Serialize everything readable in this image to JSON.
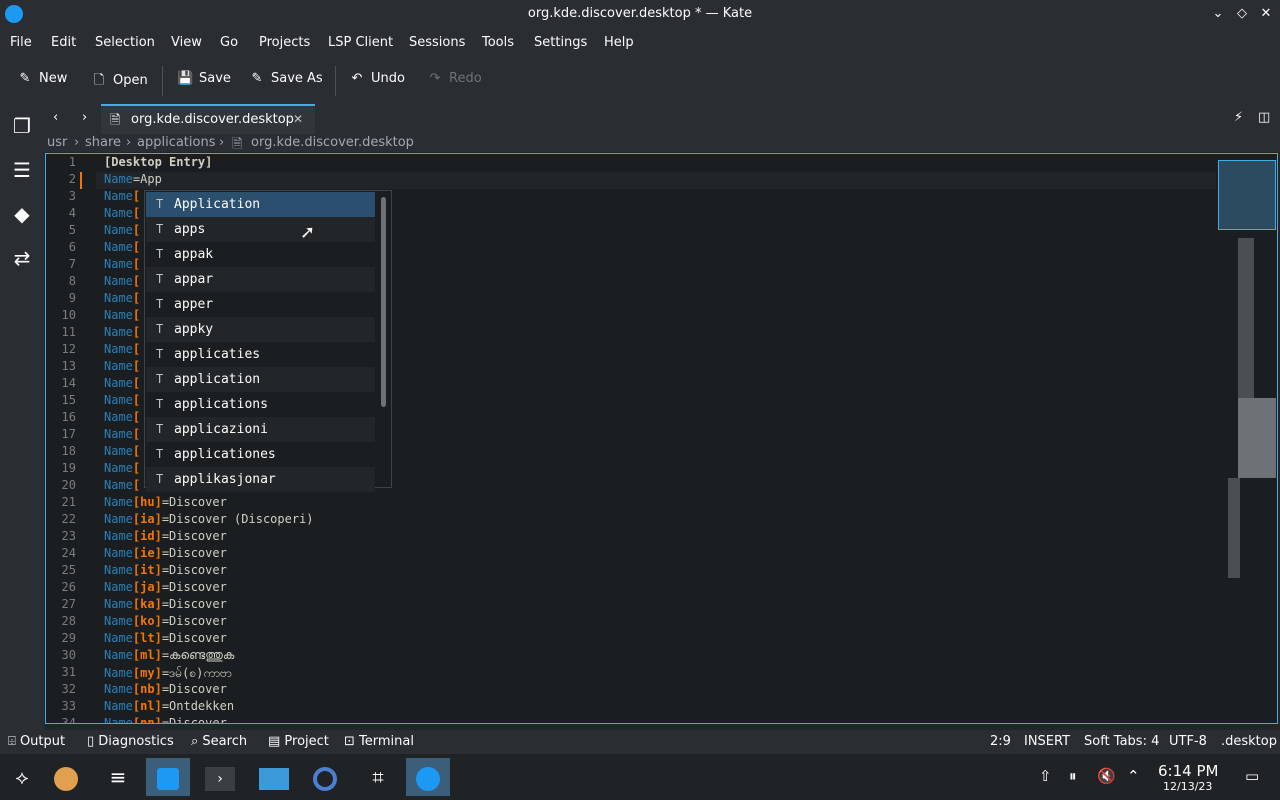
{
  "window": {
    "title": "org.kde.discover.desktop * — Kate"
  },
  "menu": [
    "File",
    "Edit",
    "Selection",
    "View",
    "Go",
    "Projects",
    "LSP Client",
    "Sessions",
    "Tools",
    "Settings",
    "Help"
  ],
  "toolbar": {
    "new": "New",
    "open": "Open",
    "save": "Save",
    "save_as": "Save As",
    "undo": "Undo",
    "redo": "Redo"
  },
  "tab": {
    "label": "org.kde.discover.desktop"
  },
  "breadcrumb": [
    "usr",
    "share",
    "applications",
    "org.kde.discover.desktop"
  ],
  "lines": [
    {
      "n": "1",
      "key": "",
      "sub": "",
      "rest": "[Desktop Entry]"
    },
    {
      "n": "2",
      "key": "Name",
      "sub": "",
      "rest": "=App"
    },
    {
      "n": "3",
      "key": "Name",
      "sub": "[",
      "rest": ""
    },
    {
      "n": "4",
      "key": "Name",
      "sub": "[",
      "rest": ""
    },
    {
      "n": "5",
      "key": "Name",
      "sub": "[",
      "rest": ""
    },
    {
      "n": "6",
      "key": "Name",
      "sub": "[",
      "rest": ""
    },
    {
      "n": "7",
      "key": "Name",
      "sub": "[",
      "rest": ""
    },
    {
      "n": "8",
      "key": "Name",
      "sub": "[",
      "rest": ""
    },
    {
      "n": "9",
      "key": "Name",
      "sub": "[",
      "rest": ""
    },
    {
      "n": "10",
      "key": "Name",
      "sub": "[",
      "rest": ""
    },
    {
      "n": "11",
      "key": "Name",
      "sub": "[",
      "rest": ""
    },
    {
      "n": "12",
      "key": "Name",
      "sub": "[",
      "rest": ""
    },
    {
      "n": "13",
      "key": "Name",
      "sub": "[",
      "rest": ""
    },
    {
      "n": "14",
      "key": "Name",
      "sub": "[",
      "rest": ""
    },
    {
      "n": "15",
      "key": "Name",
      "sub": "[",
      "rest": ""
    },
    {
      "n": "16",
      "key": "Name",
      "sub": "[",
      "rest": ""
    },
    {
      "n": "17",
      "key": "Name",
      "sub": "[",
      "rest": ""
    },
    {
      "n": "18",
      "key": "Name",
      "sub": "[",
      "rest": ""
    },
    {
      "n": "19",
      "key": "Name",
      "sub": "[",
      "rest": ""
    },
    {
      "n": "20",
      "key": "Name",
      "sub": "[",
      "rest": ""
    },
    {
      "n": "21",
      "key": "Name",
      "sub": "[hu]",
      "rest": "=Discover"
    },
    {
      "n": "22",
      "key": "Name",
      "sub": "[ia]",
      "rest": "=Discover (Discoperi)"
    },
    {
      "n": "23",
      "key": "Name",
      "sub": "[id]",
      "rest": "=Discover"
    },
    {
      "n": "24",
      "key": "Name",
      "sub": "[ie]",
      "rest": "=Discover"
    },
    {
      "n": "25",
      "key": "Name",
      "sub": "[it]",
      "rest": "=Discover"
    },
    {
      "n": "26",
      "key": "Name",
      "sub": "[ja]",
      "rest": "=Discover"
    },
    {
      "n": "27",
      "key": "Name",
      "sub": "[ka]",
      "rest": "=Discover"
    },
    {
      "n": "28",
      "key": "Name",
      "sub": "[ko]",
      "rest": "=Discover"
    },
    {
      "n": "29",
      "key": "Name",
      "sub": "[lt]",
      "rest": "=Discover"
    },
    {
      "n": "30",
      "key": "Name",
      "sub": "[ml]",
      "rest": "=കണ്ടെത്തുക"
    },
    {
      "n": "31",
      "key": "Name",
      "sub": "[my]",
      "rest": "=ဒမ်(စ)ကာဗာ"
    },
    {
      "n": "32",
      "key": "Name",
      "sub": "[nb]",
      "rest": "=Discover"
    },
    {
      "n": "33",
      "key": "Name",
      "sub": "[nl]",
      "rest": "=Ontdekken"
    },
    {
      "n": "34",
      "key": "Name",
      "sub": "[nn]",
      "rest": "=Discover"
    }
  ],
  "completions": [
    "Application",
    "apps",
    "appak",
    "appar",
    "apper",
    "appky",
    "applicaties",
    "application",
    "applications",
    "applicazioni",
    "applicationes",
    "applikasjonar"
  ],
  "bottom_tabs": {
    "output": "Output",
    "diagnostics": "Diagnostics",
    "search": "Search",
    "project": "Project",
    "terminal": "Terminal"
  },
  "status": {
    "position": "2:9",
    "mode": "INSERT",
    "indent": "Soft Tabs: 4",
    "encoding": "UTF-8",
    "filetype": ".desktop"
  },
  "clock": {
    "time": "6:14 PM",
    "date": "12/13/23"
  },
  "colors": {
    "accent": "#3daee9",
    "keyword": "#2980b9",
    "section": "#f67400"
  }
}
